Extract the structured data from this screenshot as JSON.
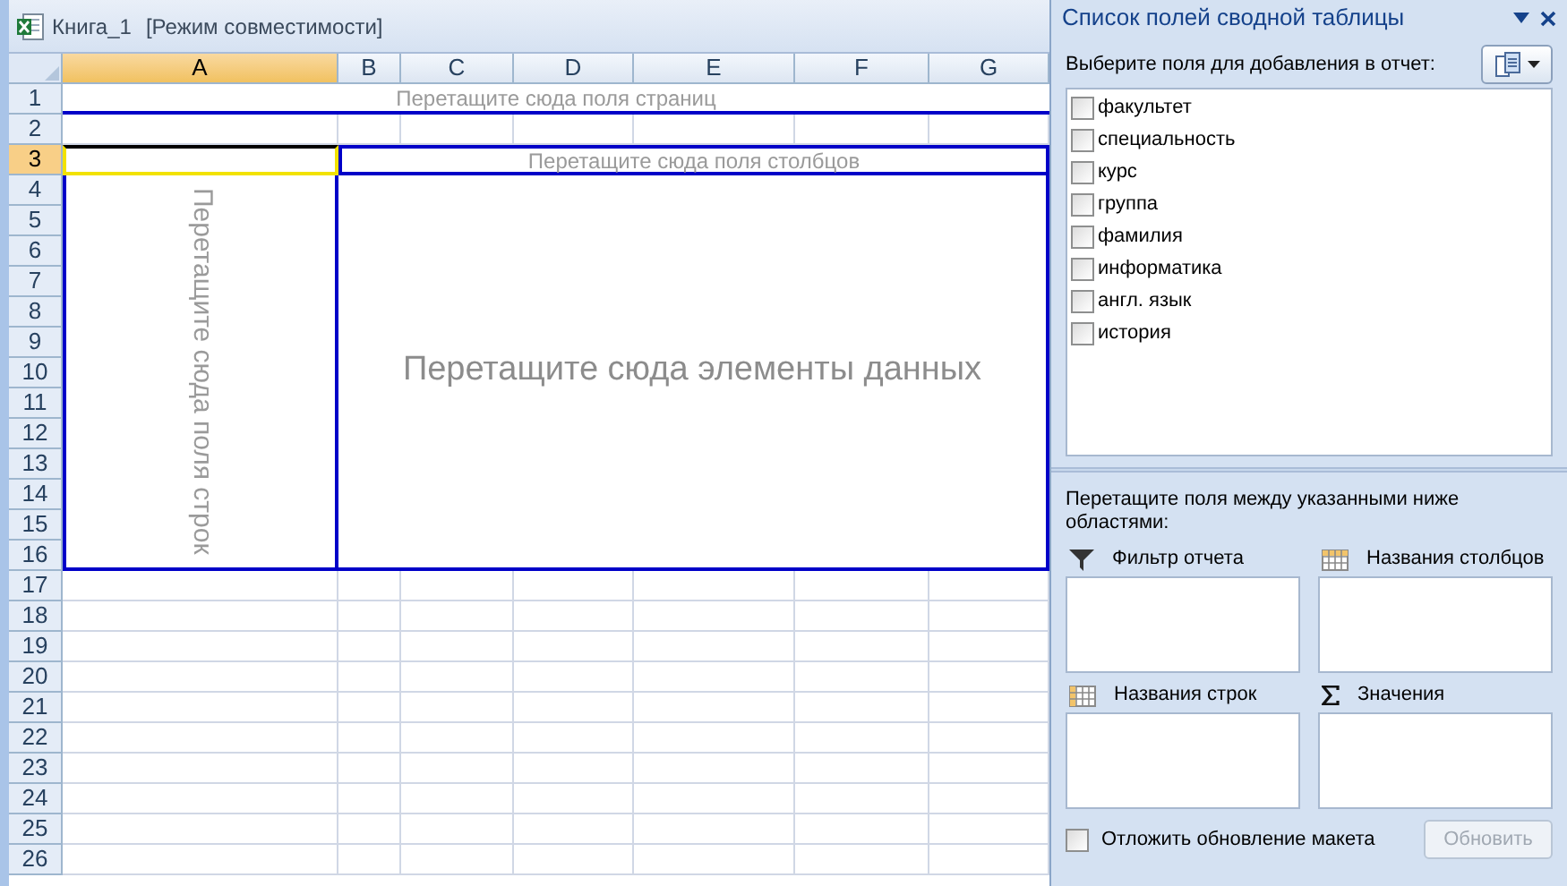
{
  "window": {
    "title": "Книга_1",
    "mode": "[Режим совместимости]"
  },
  "sheet": {
    "columns": [
      {
        "label": "A",
        "selected": true
      },
      {
        "label": "B",
        "selected": false
      },
      {
        "label": "C",
        "selected": false
      },
      {
        "label": "D",
        "selected": false
      },
      {
        "label": "E",
        "selected": false
      },
      {
        "label": "F",
        "selected": false
      },
      {
        "label": "G",
        "selected": false
      }
    ],
    "rows": [
      {
        "label": "1",
        "selected": false
      },
      {
        "label": "2",
        "selected": false
      },
      {
        "label": "3",
        "selected": true
      },
      {
        "label": "4",
        "selected": false
      },
      {
        "label": "5",
        "selected": false
      },
      {
        "label": "6",
        "selected": false
      },
      {
        "label": "7",
        "selected": false
      },
      {
        "label": "8",
        "selected": false
      },
      {
        "label": "9",
        "selected": false
      },
      {
        "label": "10",
        "selected": false
      },
      {
        "label": "11",
        "selected": false
      },
      {
        "label": "12",
        "selected": false
      },
      {
        "label": "13",
        "selected": false
      },
      {
        "label": "14",
        "selected": false
      },
      {
        "label": "15",
        "selected": false
      },
      {
        "label": "16",
        "selected": false
      },
      {
        "label": "17",
        "selected": false
      },
      {
        "label": "18",
        "selected": false
      },
      {
        "label": "19",
        "selected": false
      },
      {
        "label": "20",
        "selected": false
      },
      {
        "label": "21",
        "selected": false
      },
      {
        "label": "22",
        "selected": false
      },
      {
        "label": "23",
        "selected": false
      },
      {
        "label": "24",
        "selected": false
      },
      {
        "label": "25",
        "selected": false
      },
      {
        "label": "26",
        "selected": false
      }
    ],
    "pivot_drop_zones": {
      "page_fields": "Перетащите сюда поля страниц",
      "column_fields": "Перетащите сюда поля столбцов",
      "row_fields": "Перетащите сюда поля строк",
      "data_items": "Перетащите сюда элементы данных"
    }
  },
  "panel": {
    "title": "Список полей сводной таблицы",
    "prompt": "Выберите поля для добавления в отчет:",
    "fields": [
      {
        "label": "факультет",
        "checked": false
      },
      {
        "label": "специальность",
        "checked": false
      },
      {
        "label": "курс",
        "checked": false
      },
      {
        "label": "группа",
        "checked": false
      },
      {
        "label": "фамилия",
        "checked": false
      },
      {
        "label": "информатика",
        "checked": false
      },
      {
        "label": "англ. язык",
        "checked": false
      },
      {
        "label": "история",
        "checked": false
      }
    ],
    "drag_hint": "Перетащите поля между указанными ниже областями:",
    "areas": [
      {
        "kind": "filter",
        "label": "Фильтр отчета"
      },
      {
        "kind": "columns",
        "label": "Названия столбцов"
      },
      {
        "kind": "rows",
        "label": "Названия строк"
      },
      {
        "kind": "values",
        "label": "Значения"
      }
    ],
    "defer": {
      "label": "Отложить обновление макета",
      "checked": false
    },
    "update_button": {
      "label": "Обновить",
      "disabled": true
    }
  }
}
